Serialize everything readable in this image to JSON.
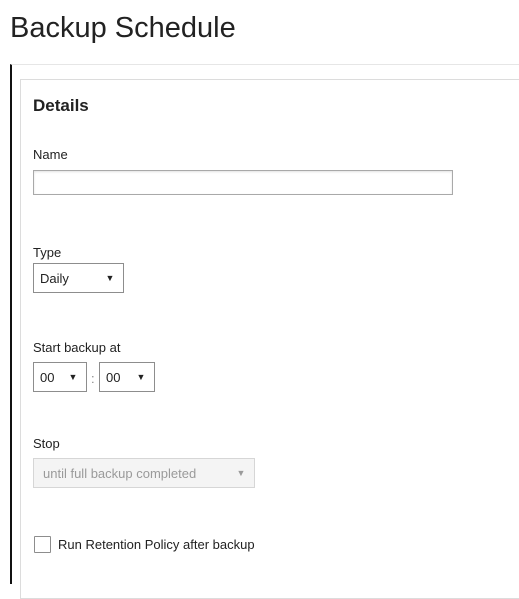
{
  "page": {
    "title": "Backup Schedule"
  },
  "details": {
    "heading": "Details",
    "name": {
      "label": "Name",
      "value": "",
      "placeholder": ""
    },
    "type": {
      "label": "Type",
      "selected": "Daily"
    },
    "start_backup": {
      "label": "Start backup at",
      "hour": "00",
      "separator": ":",
      "minute": "00"
    },
    "stop": {
      "label": "Stop",
      "selected": "until full backup completed",
      "disabled": true
    },
    "retention": {
      "label": "Run Retention Policy after backup",
      "checked": false
    }
  },
  "icons": {
    "dropdown_arrow": "▼"
  }
}
